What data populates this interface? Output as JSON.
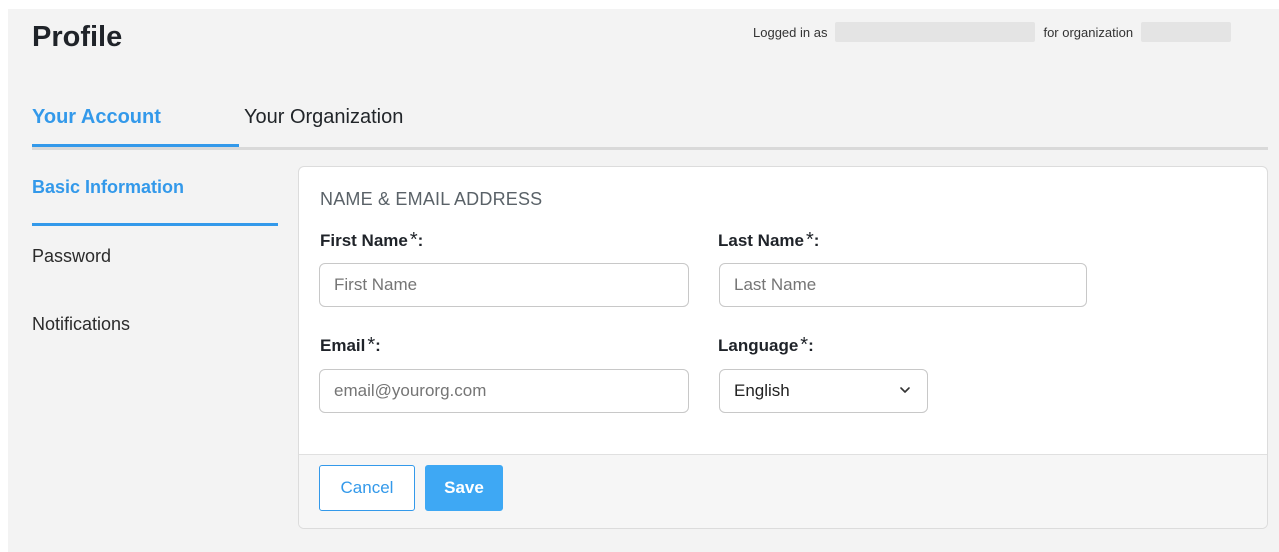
{
  "header": {
    "title": "Profile",
    "logged_in_as_label": "Logged in as",
    "for_organization_label": "for organization"
  },
  "tabs": [
    {
      "label": "Your Account",
      "active": true
    },
    {
      "label": "Your Organization",
      "active": false
    }
  ],
  "sidebar": {
    "items": [
      {
        "label": "Basic Information",
        "active": true
      },
      {
        "label": "Password",
        "active": false
      },
      {
        "label": "Notifications",
        "active": false
      }
    ]
  },
  "form": {
    "section_title": "NAME & EMAIL ADDRESS",
    "required_marker": "*",
    "first_name": {
      "label": "First Name",
      "placeholder": "First Name"
    },
    "last_name": {
      "label": "Last Name",
      "placeholder": "Last Name"
    },
    "email": {
      "label": "Email",
      "placeholder": "email@yourorg.com"
    },
    "language": {
      "label": "Language",
      "value": "English"
    },
    "colon": ":"
  },
  "buttons": {
    "cancel": "Cancel",
    "save": "Save"
  },
  "colors": {
    "accent": "#3399ea",
    "save_bg": "#3ea8f4"
  },
  "icons": {
    "select_chevron": "chevron-down-icon"
  }
}
